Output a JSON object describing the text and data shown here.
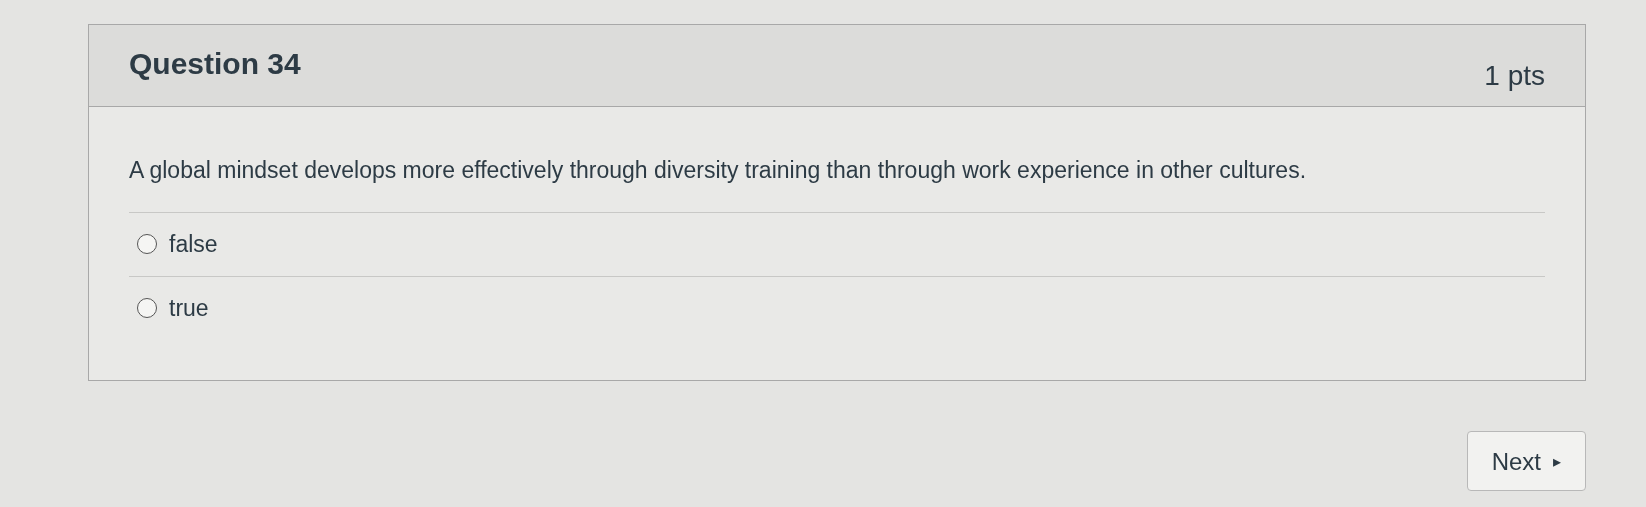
{
  "question": {
    "title": "Question 34",
    "points": "1 pts",
    "text": "A global mindset develops more effectively through diversity training than through work experience in other cultures.",
    "options": [
      {
        "label": "false",
        "selected": false
      },
      {
        "label": "true",
        "selected": false
      }
    ]
  },
  "next_button": {
    "label": "Next",
    "icon": "▸"
  }
}
